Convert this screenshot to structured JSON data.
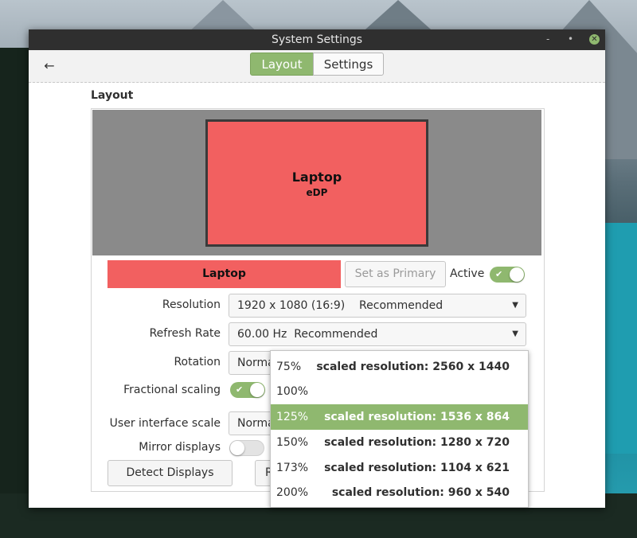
{
  "window": {
    "title": "System Settings",
    "controls": {
      "minimize": "-",
      "maximize": "•",
      "close": "✕"
    }
  },
  "header": {
    "back_icon": "←",
    "tabs": [
      {
        "label": "Layout",
        "selected": true
      },
      {
        "label": "Settings",
        "selected": false
      }
    ]
  },
  "layout": {
    "section_title": "Layout",
    "monitor_preview": {
      "name": "Laptop",
      "connector": "eDP"
    },
    "monitor_bar": {
      "label": "Laptop",
      "set_primary_label": "Set as Primary",
      "active_label": "Active",
      "active": true
    },
    "rows": {
      "resolution": {
        "label": "Resolution",
        "value": "1920 x 1080 (16:9)    Recommended"
      },
      "refresh_rate": {
        "label": "Refresh Rate",
        "value": "60.00 Hz  Recommended"
      },
      "rotation": {
        "label": "Rotation",
        "value": "Normal"
      },
      "fractional_scaling": {
        "label": "Fractional scaling",
        "enabled": true
      },
      "ui_scale": {
        "label": "User interface scale",
        "value": "Normal"
      },
      "mirror": {
        "label": "Mirror displays",
        "enabled": false
      }
    },
    "buttons": {
      "detect": "Detect Displays",
      "second": "R"
    },
    "scale_popup": {
      "selected_index": 2,
      "options": [
        {
          "pct": "75%",
          "res": "scaled resolution: 2560 x 1440"
        },
        {
          "pct": "100%",
          "res": ""
        },
        {
          "pct": "125%",
          "res": "scaled resolution: 1536 x 864"
        },
        {
          "pct": "150%",
          "res": "scaled resolution: 1280 x 720"
        },
        {
          "pct": "173%",
          "res": "scaled resolution: 1104 x 621"
        },
        {
          "pct": "200%",
          "res": "scaled resolution: 960 x 540"
        }
      ]
    }
  },
  "colors": {
    "accent": "#8fb86f",
    "monitor": "#f26060",
    "titlebar": "#2f2f2f"
  }
}
